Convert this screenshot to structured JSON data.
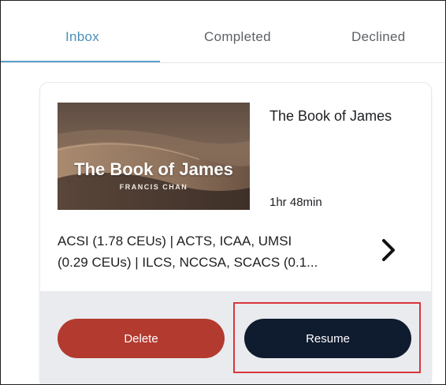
{
  "tabs": [
    {
      "label": "Inbox",
      "active": true
    },
    {
      "label": "Completed",
      "active": false
    },
    {
      "label": "Declined",
      "active": false
    }
  ],
  "course": {
    "thumbnail_title": "The Book of James",
    "thumbnail_author": "FRANCIS CHAN",
    "title": "The Book of James",
    "duration": "1hr 48min",
    "credits_line1": "ACSI (1.78 CEUs) | ACTS, ICAA, UMSI",
    "credits_line2": "(0.29 CEUs) | ILCS, NCCSA, SCACS (0.1..."
  },
  "actions": {
    "delete_label": "Delete",
    "resume_label": "Resume"
  },
  "icons": {
    "details": "chevron-right-icon"
  },
  "colors": {
    "active_tab": "#4a8fb8",
    "delete": "#b33a2f",
    "resume": "#0f1b2f",
    "highlight": "#d9353b"
  }
}
